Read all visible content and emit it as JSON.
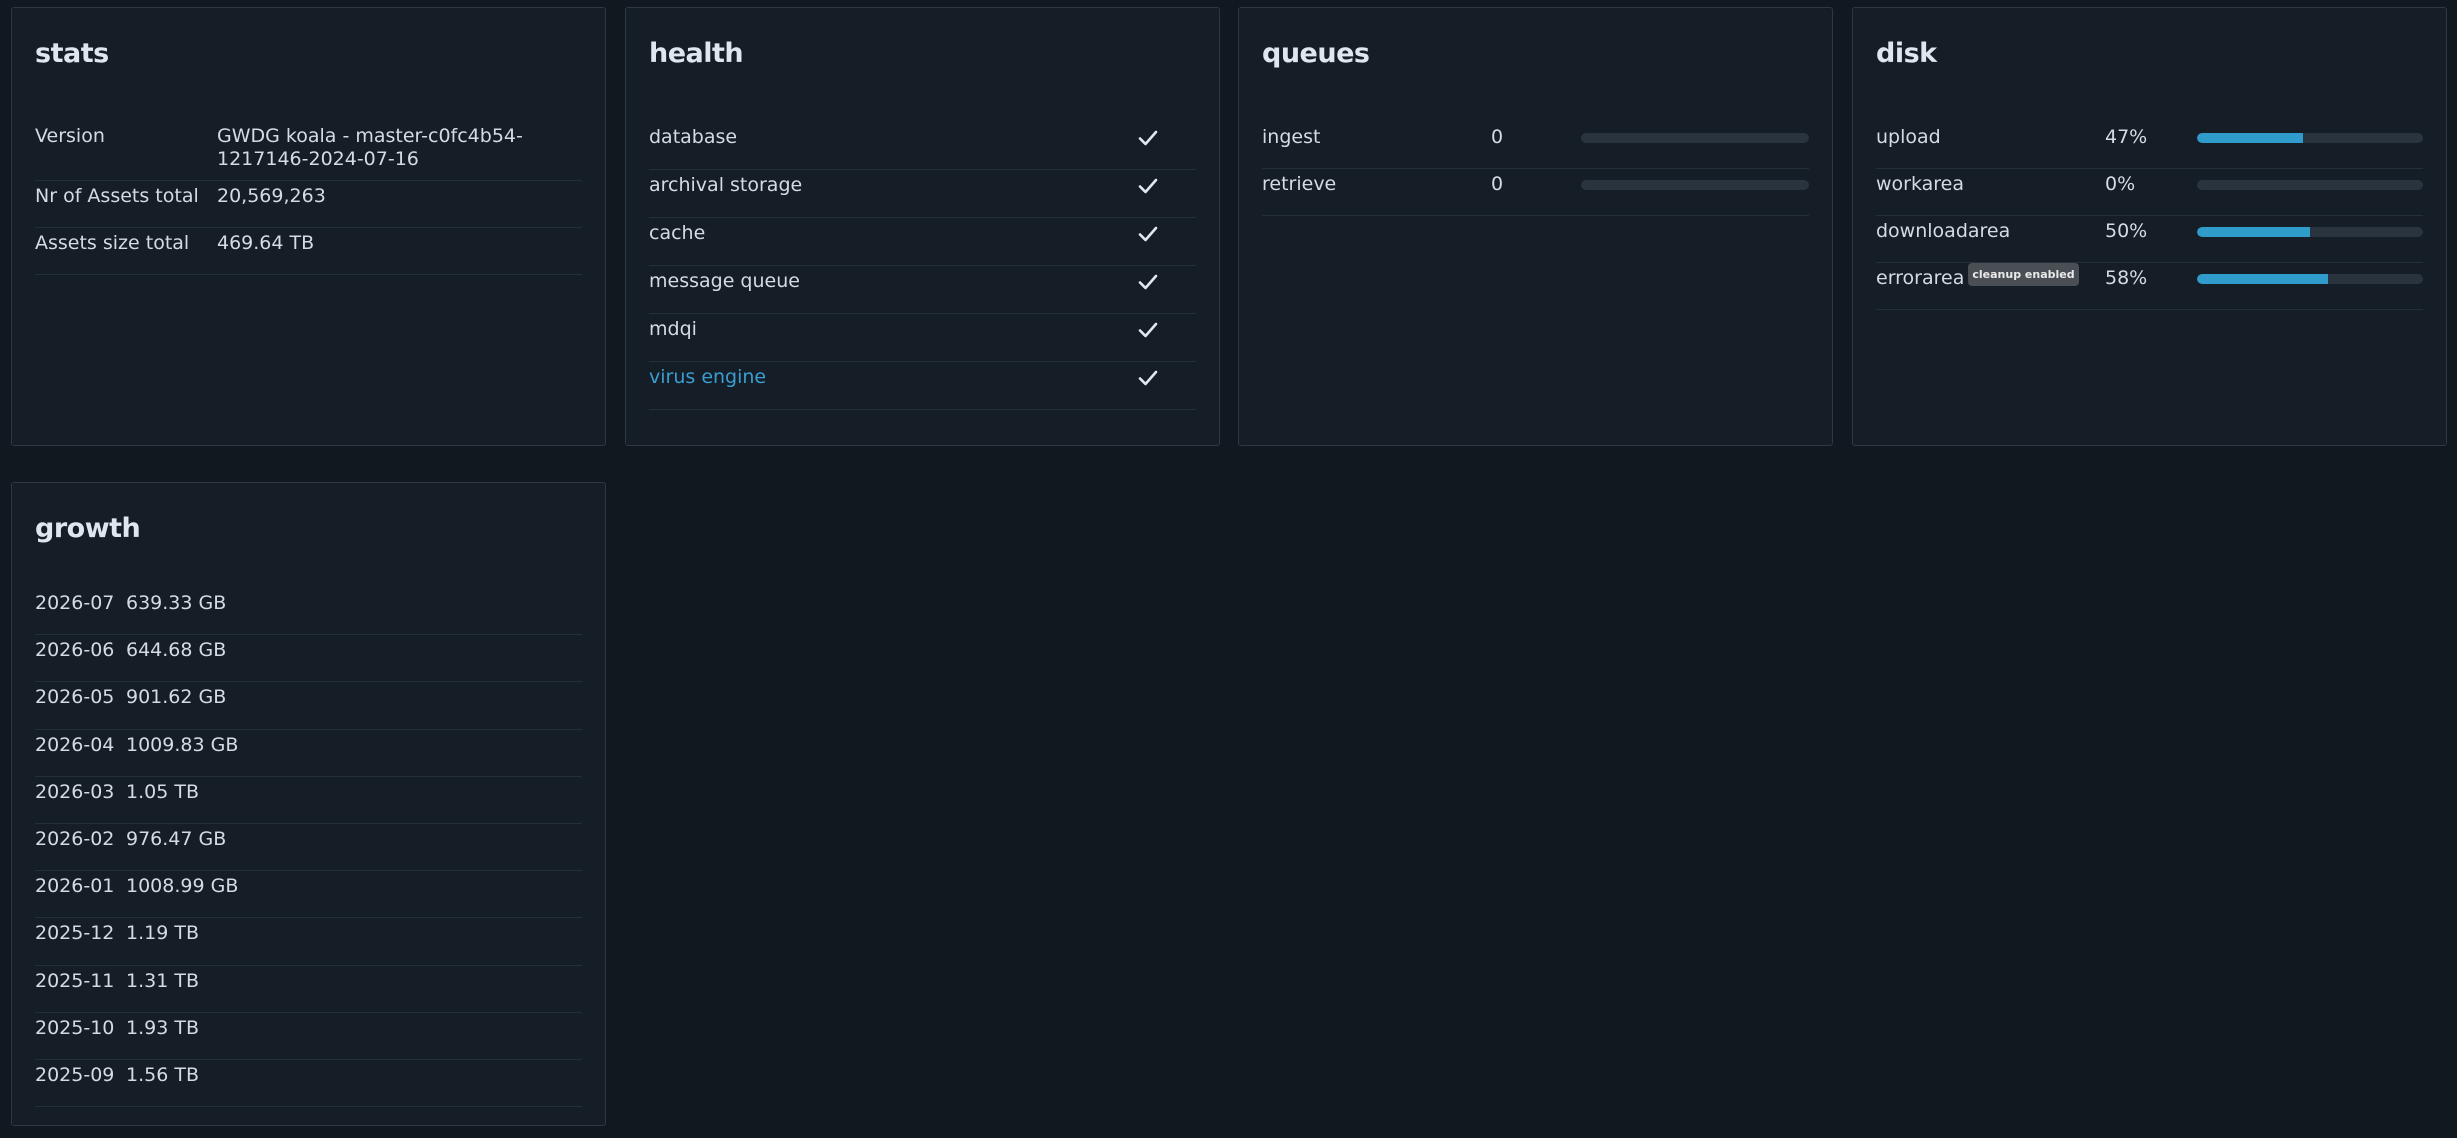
{
  "colors": {
    "background": "#111820",
    "card": "#151d26",
    "accent": "#2f9ccb",
    "link": "#3a9ed2"
  },
  "stats": {
    "title": "stats",
    "rows": [
      {
        "label": "Version",
        "value": "GWDG koala - master-c0fc4b54-1217146-2024-07-16"
      },
      {
        "label": "Nr of Assets total",
        "value": "20,569,263"
      },
      {
        "label": "Assets size total",
        "value": "469.64 TB"
      }
    ]
  },
  "health": {
    "title": "health",
    "rows": [
      {
        "label": "database",
        "status_icon": "check-icon"
      },
      {
        "label": "archival storage",
        "status_icon": "check-icon"
      },
      {
        "label": "cache",
        "status_icon": "check-icon"
      },
      {
        "label": "message queue",
        "status_icon": "check-icon"
      },
      {
        "label": "mdqi",
        "status_icon": "check-icon"
      },
      {
        "label": "virus engine",
        "status_icon": "check-icon",
        "is_link": true
      }
    ]
  },
  "queues": {
    "title": "queues",
    "rows": [
      {
        "label": "ingest",
        "count": "0",
        "fill": 0
      },
      {
        "label": "retrieve",
        "count": "0",
        "fill": 0
      }
    ]
  },
  "disk": {
    "title": "disk",
    "rows": [
      {
        "label": "upload",
        "percent": "47%",
        "fill": 47
      },
      {
        "label": "workarea",
        "percent": "0%",
        "fill": 0
      },
      {
        "label": "downloadarea",
        "percent": "50%",
        "fill": 50
      },
      {
        "label": "errorarea",
        "badge": "cleanup enabled",
        "percent": "58%",
        "fill": 58
      }
    ]
  },
  "growth": {
    "title": "growth",
    "rows": [
      {
        "month": "2026-07",
        "size": "639.33 GB"
      },
      {
        "month": "2026-06",
        "size": "644.68 GB"
      },
      {
        "month": "2026-05",
        "size": "901.62 GB"
      },
      {
        "month": "2026-04",
        "size": "1009.83 GB"
      },
      {
        "month": "2026-03",
        "size": "1.05 TB"
      },
      {
        "month": "2026-02",
        "size": "976.47 GB"
      },
      {
        "month": "2026-01",
        "size": "1008.99 GB"
      },
      {
        "month": "2025-12",
        "size": "1.19 TB"
      },
      {
        "month": "2025-11",
        "size": "1.31 TB"
      },
      {
        "month": "2025-10",
        "size": "1.93 TB"
      },
      {
        "month": "2025-09",
        "size": "1.56 TB"
      }
    ]
  }
}
